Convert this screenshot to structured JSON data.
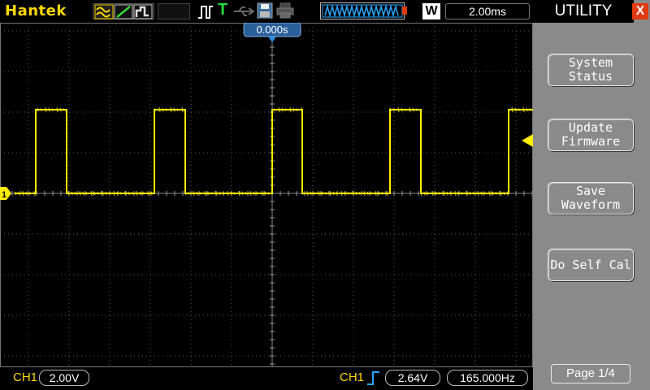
{
  "header": {
    "brand": "Hantek",
    "timebase": "2.00ms",
    "timebase_mode": "W",
    "trigger_status": "T"
  },
  "screen": {
    "trigger_offset": "0.000s",
    "channel_marker": "1",
    "trace_color": "#ffee00"
  },
  "footer": {
    "channel_label": "CH1",
    "volts_per_div": "2.00V",
    "trigger_source": "CH1",
    "trigger_level": "2.64V",
    "frequency": "165.000Hz"
  },
  "panel": {
    "title": "UTILITY",
    "close": "X",
    "buttons": [
      {
        "label": "System\nStatus"
      },
      {
        "label": "Update\nFirmware"
      },
      {
        "label": "Save\nWaveform"
      },
      {
        "label": "Do Self Cal"
      }
    ],
    "page": "Page 1/4"
  },
  "colors": {
    "brand": "#ffd800",
    "trace": "#ffee00",
    "panel_bg": "#8a8a8a",
    "close_btn": "#e03a10",
    "timebase_icon": "#29a8ff"
  },
  "icons": [
    "acquire-mode-icon",
    "trigger-edge-icon",
    "run-status-icon",
    "save-icon",
    "print-icon",
    "memory-waveform-icon",
    "usb-icon"
  ]
}
